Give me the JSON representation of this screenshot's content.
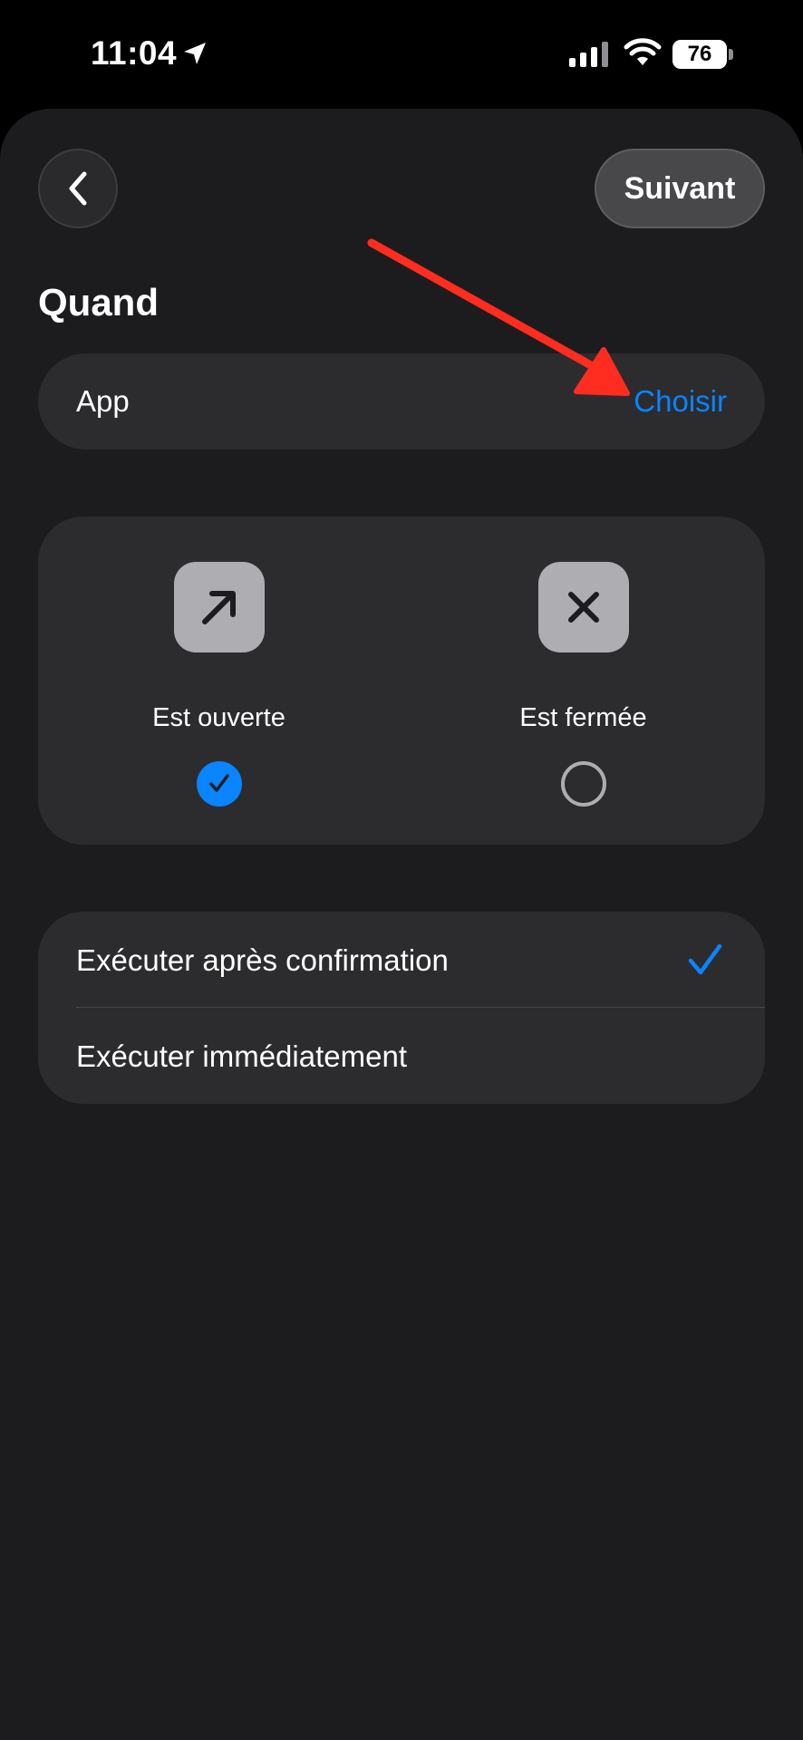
{
  "status_bar": {
    "time": "11:04",
    "battery": "76"
  },
  "header": {
    "back_icon": "chevron-left-icon",
    "next_label": "Suivant"
  },
  "section": {
    "title": "Quand"
  },
  "app_row": {
    "label": "App",
    "action": "Choisir"
  },
  "trigger_options": [
    {
      "label": "Est ouverte",
      "icon": "arrow-up-right-icon",
      "selected": true
    },
    {
      "label": "Est fermée",
      "icon": "xmark-icon",
      "selected": false
    }
  ],
  "run_options": [
    {
      "label": "Exécuter après confirmation",
      "selected": true
    },
    {
      "label": "Exécuter immédiatement",
      "selected": false
    }
  ],
  "colors": {
    "accent": "#0a84ff",
    "background": "#1c1c1e",
    "card": "#2c2c2e",
    "annotation": "#ff2d1f"
  }
}
